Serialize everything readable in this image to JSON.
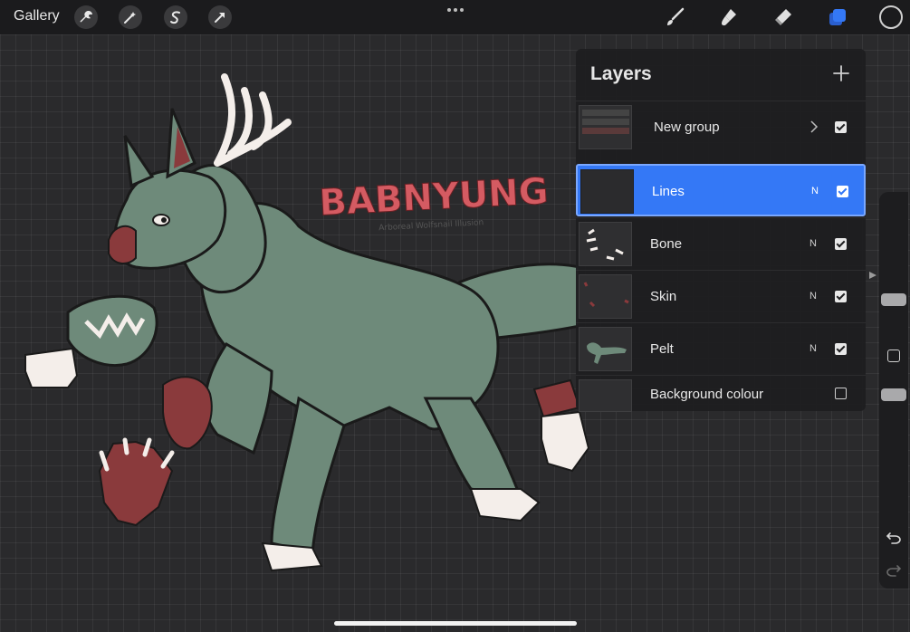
{
  "topbar": {
    "gallery_label": "Gallery",
    "left_tools": [
      "wrench-icon",
      "magic-wand-icon",
      "selection-icon",
      "transform-arrow-icon"
    ],
    "right_tools": [
      "brush-icon",
      "smudge-icon",
      "eraser-icon",
      "layers-icon"
    ],
    "active_tool": "layers-icon",
    "current_color": "#1b1b1d",
    "accent": "#3478f6"
  },
  "artwork": {
    "title_text": "BABNYUNG",
    "subtitle_text": "Arboreal Wolfsnail Illusion",
    "colors": {
      "pelt": "#6e8a7a",
      "skin": "#8a3a3c",
      "bone": "#f4eeea",
      "title": "#d45b62"
    }
  },
  "layers": {
    "title": "Layers",
    "items": [
      {
        "name": "New group",
        "blend": "",
        "visible": true,
        "group": true
      },
      {
        "name": "Lines",
        "blend": "N",
        "visible": true,
        "selected": true
      },
      {
        "name": "Bone",
        "blend": "N",
        "visible": true
      },
      {
        "name": "Skin",
        "blend": "N",
        "visible": true
      },
      {
        "name": "Pelt",
        "blend": "N",
        "visible": true
      },
      {
        "name": "Background colour",
        "blend": "",
        "visible": false
      }
    ]
  },
  "sidebar": {
    "icons": [
      "undo-icon",
      "redo-icon"
    ]
  }
}
